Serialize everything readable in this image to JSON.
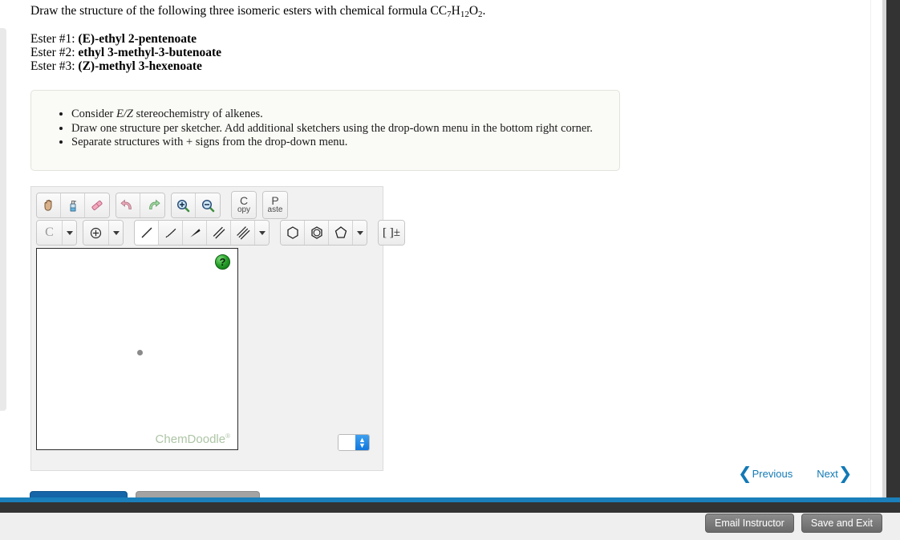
{
  "prompt": {
    "lead": "Draw the structure of the following three isomeric esters with chemical formula C",
    "sub1": "7",
    "el1": "H",
    "sub2": "12",
    "el2": "O",
    "sub3": "2",
    "tail": "."
  },
  "esters": [
    {
      "label": "Ester #1:",
      "name": "(E)-ethyl 2-pentenoate"
    },
    {
      "label": "Ester #2:",
      "name": "ethyl 3-methyl-3-butenoate"
    },
    {
      "label": "Ester #3:",
      "name": "(Z)-methyl 3-hexenoate"
    }
  ],
  "notes": [
    {
      "pre": "Consider ",
      "em": "E/Z",
      "post": " stereochemistry of alkenes."
    },
    {
      "pre": "Draw one structure per sketcher. Add additional sketchers using the drop-down menu in the bottom right corner.",
      "em": "",
      "post": ""
    },
    {
      "pre": "Separate structures with + signs from the drop-down menu.",
      "em": "",
      "post": ""
    }
  ],
  "sketcher": {
    "toolbar_row1": [
      {
        "icon": "hand-pan-icon",
        "tip": "Move / Pan"
      },
      {
        "icon": "clear-spray-bottle-icon",
        "tip": "Clear"
      },
      {
        "icon": "eraser-icon",
        "tip": "Erase"
      },
      {
        "icon": "undo-arrow-icon",
        "tip": "Undo"
      },
      {
        "icon": "redo-arrow-icon",
        "tip": "Redo"
      },
      {
        "icon": "zoom-in-icon",
        "tip": "Zoom In"
      },
      {
        "icon": "zoom-out-icon",
        "tip": "Zoom Out"
      }
    ],
    "copy_big": "C",
    "copy_small": "opy",
    "paste_big": "P",
    "paste_small": "aste",
    "element_label": "C",
    "charge_glyph": "⊕",
    "bracket_label": "[ ]±",
    "bond_tools": [
      {
        "icon": "single-bond-icon",
        "selected": true
      },
      {
        "icon": "hashed-wedge-bond-icon",
        "selected": false
      },
      {
        "icon": "solid-wedge-bond-icon",
        "selected": false
      },
      {
        "icon": "double-bond-icon",
        "selected": false
      },
      {
        "icon": "triple-bond-icon",
        "selected": false
      }
    ],
    "ring_tools": [
      {
        "icon": "cyclohexane-ring-icon"
      },
      {
        "icon": "benzene-ring-icon"
      },
      {
        "icon": "cyclopentane-ring-icon"
      }
    ],
    "help_glyph": "?",
    "watermark": "ChemDoodle",
    "watermark_mark": "®",
    "spinner_value": "",
    "spinner_up": "▲",
    "spinner_down": "▼"
  },
  "nav": {
    "previous_label": "Previous",
    "previous_chev": "❮",
    "next_label": "Next",
    "next_chev": "❯"
  },
  "footer": {
    "email_instructor_label": "Email Instructor",
    "save_and_exit_label": "Save and Exit"
  },
  "colors": {
    "accent_blue": "#1a7fba",
    "link_blue": "#1279b5",
    "dark_bar": "#333333",
    "notebox_bg": "#fafaf6",
    "watermark_green": "#aec5a6",
    "help_green": "#27a02a"
  }
}
